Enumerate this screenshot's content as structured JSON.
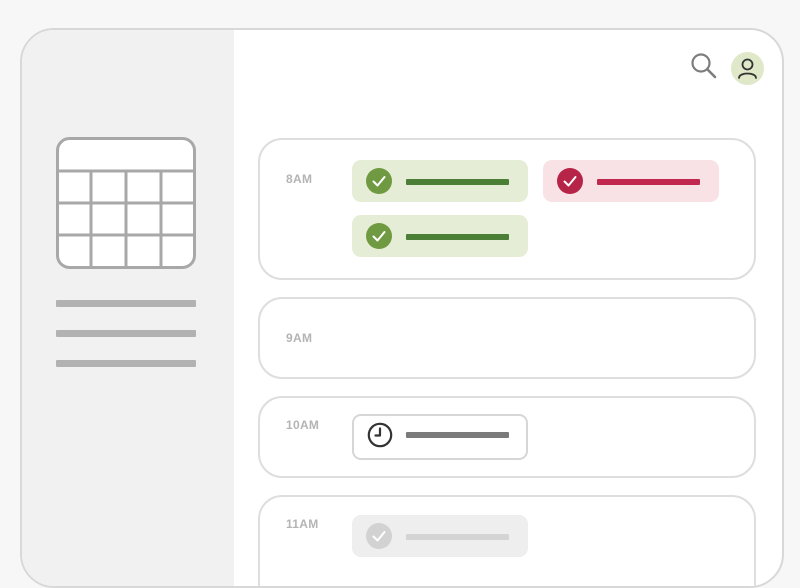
{
  "sidebar": {
    "calendar_icon": "calendar-grid-icon",
    "menu_line_count": 3
  },
  "topbar": {
    "search_icon": "search-icon",
    "avatar_icon": "user-icon"
  },
  "colors": {
    "confirmed_bg": "#e6edd6",
    "confirmed_accent": "#4a7f35",
    "declined_bg": "#f8e2e6",
    "declined_accent": "#c12850",
    "pending_accent": "#7a7a7a",
    "faded_bg": "#eeeeee",
    "avatar_bg": "#dfe8c8"
  },
  "schedule": [
    {
      "time": "8AM",
      "events": [
        {
          "status": "confirmed",
          "icon": "check-circle-icon"
        },
        {
          "status": "declined",
          "icon": "check-circle-icon"
        },
        {
          "status": "confirmed",
          "icon": "check-circle-icon"
        }
      ]
    },
    {
      "time": "9AM",
      "events": []
    },
    {
      "time": "10AM",
      "events": [
        {
          "status": "pending",
          "icon": "clock-icon"
        }
      ]
    },
    {
      "time": "11AM",
      "events": [
        {
          "status": "faded",
          "icon": "check-circle-icon"
        }
      ]
    }
  ]
}
